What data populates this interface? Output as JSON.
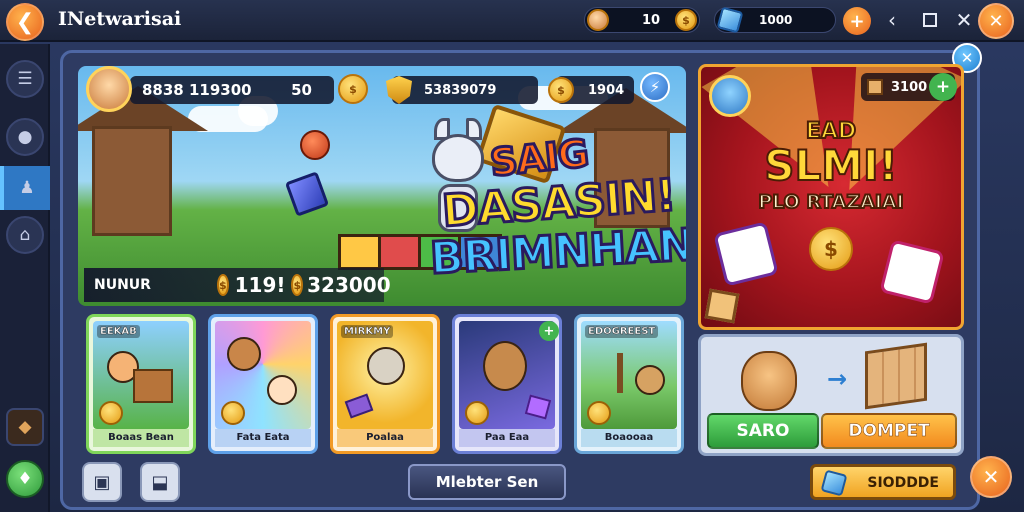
{
  "app": {
    "title": "INetwarisai"
  },
  "header": {
    "back_icon": "arrow-left-icon",
    "currency_a": {
      "icon": "avatar-coin-icon",
      "value": "10"
    },
    "currency_b": {
      "icon": "gem-icon",
      "value": "1000"
    },
    "add_icon": "plus-icon"
  },
  "panel": {
    "player_stats": {
      "left": "8838 119300",
      "right": "50"
    },
    "gem_stat": "53839079",
    "coin_stat": "1904",
    "scene_title": {
      "line1": "SAIG",
      "line2": "DASASIN!",
      "line3": "BRIMNHAN!"
    },
    "level": {
      "label": "NUNUR",
      "value1": "119!",
      "value2": "323000"
    },
    "cards": [
      {
        "tag": "EEKAB",
        "name": "Boaas Bean"
      },
      {
        "tag": "",
        "name": "Fata Eata"
      },
      {
        "tag": "MIRKMY",
        "name": "Poalaa"
      },
      {
        "tag": "",
        "name": "Paa Eaa"
      },
      {
        "tag": "EDOGREEST",
        "name": "Boaooaa"
      }
    ],
    "center_button": "Mlebter Sen"
  },
  "promo": {
    "price": "3100",
    "line1": "EAD",
    "line2": "SLMI!",
    "line3": "PLO RTAZAIAI"
  },
  "trade": {
    "arrow": "→",
    "left_button": "SARO",
    "right_button": "DOMPET"
  },
  "footer": {
    "right_button": "SIODDDE"
  },
  "colors": {
    "accent": "#f28a1e",
    "panel": "#2e3b62",
    "green": "#41b84f",
    "orange": "#f5a21e",
    "blue": "#2f78c4"
  }
}
